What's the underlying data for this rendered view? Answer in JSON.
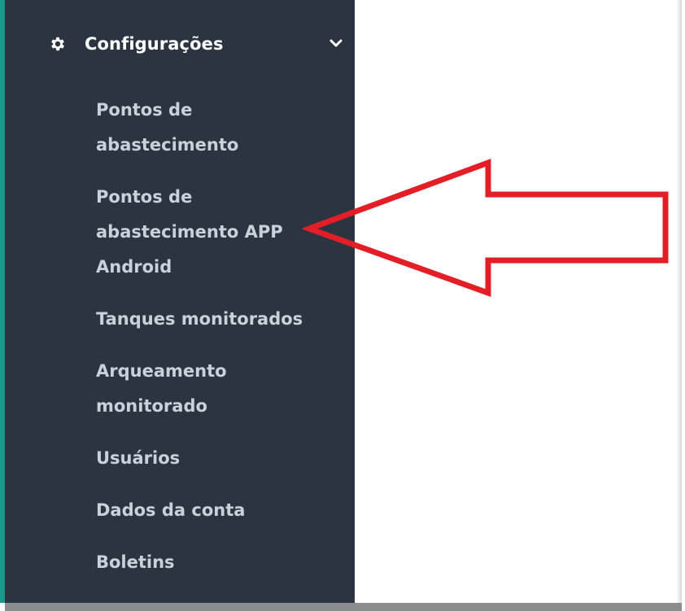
{
  "sidebar": {
    "section": {
      "icon": "gear-icon",
      "label": "Configurações",
      "chevron": "chevron-down-icon"
    },
    "items": [
      {
        "label": "Pontos de abastecimento"
      },
      {
        "label": "Pontos de abastecimento APP Android"
      },
      {
        "label": "Tanques monitorados"
      },
      {
        "label": "Arqueamento monitorado"
      },
      {
        "label": "Usuários"
      },
      {
        "label": "Dados da conta"
      },
      {
        "label": "Boletins"
      }
    ]
  },
  "annotation": {
    "arrow_color": "#e41e26",
    "points_to": "Pontos de abastecimento APP Android"
  },
  "colors": {
    "sidebar_bg": "#2a3541",
    "accent_border": "#1a9a8a",
    "menu_text": "#c9d1d9",
    "header_text": "#ffffff"
  }
}
